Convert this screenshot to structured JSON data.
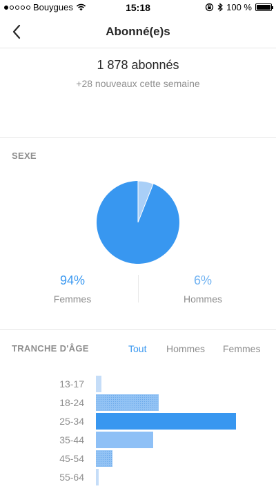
{
  "status_bar": {
    "carrier": "Bouygues",
    "time": "15:18",
    "battery": "100 %",
    "signal_bars": 1
  },
  "nav": {
    "title": "Abonné(e)s",
    "back_icon": "chevron-left-icon"
  },
  "summary": {
    "count": "1 878 abonnés",
    "new_this_week": "+28 nouveaux cette semaine"
  },
  "gender": {
    "label": "SEXE",
    "female_pct": "94%",
    "female_label": "Femmes",
    "male_pct": "6%",
    "male_label": "Hommes",
    "female_share": 94,
    "male_share": 6
  },
  "age": {
    "label": "TRANCHE D'ÂGE",
    "tabs": [
      "Tout",
      "Hommes",
      "Femmes"
    ],
    "active_tab": "Tout"
  },
  "colors": {
    "accent": "#3897f0",
    "male_light": "#a9cff7",
    "text_secondary": "#8e8e8e"
  },
  "chart_data": {
    "type": "bar",
    "orientation": "horizontal",
    "categories": [
      "13-17",
      "18-24",
      "25-34",
      "35-44",
      "45-54",
      "55-64"
    ],
    "values": [
      4,
      45,
      100,
      41,
      12,
      2
    ],
    "value_scale": "relative share of followers, largest bucket = 100 (estimated, no axis printed)"
  }
}
